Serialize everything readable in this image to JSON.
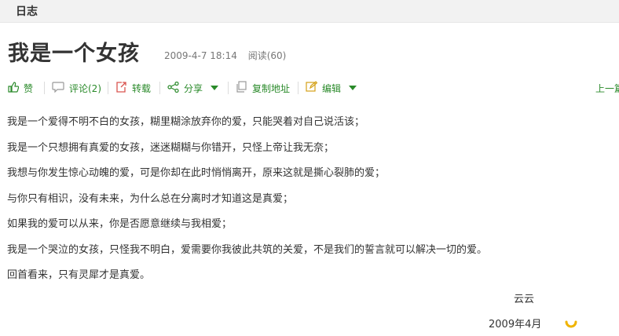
{
  "section": {
    "title": "日志"
  },
  "post": {
    "title": "我是一个女孩",
    "date": "2009-4-7 18:14",
    "reads": "阅读(60)"
  },
  "toolbar": {
    "like": "赞",
    "comment": "评论(2)",
    "repost": "转载",
    "share": "分享",
    "copy_address": "复制地址",
    "edit": "编辑",
    "prev": "上一篇"
  },
  "content": {
    "paragraphs": [
      "我是一个爱得不明不白的女孩，糊里糊涂放弃你的爱，只能哭着对自己说活该；",
      "我是一个只想拥有真爱的女孩，迷迷糊糊与你错开，只怪上帝让我无奈；",
      "我想与你发生惊心动魄的爱，可是你却在此时悄悄离开，原来这就是撕心裂肺的爱；",
      "与你只有相识，没有未来，为什么总在分离时才知道这是真爱；",
      "如果我的爱可以从来，你是否愿意继续与我相爱；",
      "我是一个哭泣的女孩，只怪我不明白，爱需要你我彼此共筑的关爱，不是我们的誓言就可以解决一切的爱。",
      "回首看来，只有灵犀才是真爱。"
    ],
    "signature": "云云",
    "date_partial": "2009年4月"
  },
  "colors": {
    "accent": "#2a8a2a",
    "header_bg": "#f2f2f2",
    "loader": "#f0b400"
  }
}
